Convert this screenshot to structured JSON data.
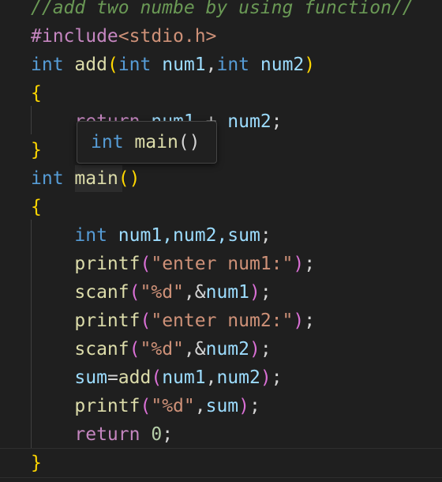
{
  "code": {
    "line1": {
      "comment": "//add two numbe by using function//"
    },
    "line2": {
      "directive": "#include",
      "header": "<stdio.h>"
    },
    "line3": {
      "kw_int": "int",
      "fn_name": "add",
      "open_paren": "(",
      "param1_type": "int",
      "param1_name": "num1",
      "comma": ",",
      "param2_type": "int",
      "param2_name": "num2",
      "close_paren": ")"
    },
    "line4": {
      "brace": "{"
    },
    "line5": {
      "kw_return": "return",
      "var1": "num1",
      "op": " + ",
      "var2": "num2",
      "semi": ";"
    },
    "line6": {
      "brace": "}"
    },
    "line7": {
      "kw_int": "int",
      "fn_name": "main",
      "parens": "()"
    },
    "line8": {
      "brace": "{"
    },
    "line9": {
      "kw_int": "int",
      "decl": "num1,num2,sum",
      "semi": ";"
    },
    "line10": {
      "fn": "printf",
      "open": "(",
      "str": "\"enter num1:\"",
      "close": ")",
      "semi": ";"
    },
    "line11": {
      "fn": "scanf",
      "open": "(",
      "str": "\"%d\"",
      "comma": ",&",
      "var": "num1",
      "close": ")",
      "semi": ";"
    },
    "line12": {
      "fn": "printf",
      "open": "(",
      "str": "\"enter num2:\"",
      "close": ")",
      "semi": ";"
    },
    "line13": {
      "fn": "scanf",
      "open": "(",
      "str": "\"%d\"",
      "comma": ",&",
      "var": "num2",
      "close": ")",
      "semi": ";"
    },
    "line14": {
      "var": "sum",
      "eq": "=",
      "fn": "add",
      "open": "(",
      "arg1": "num1",
      "comma": ",",
      "arg2": "num2",
      "close": ")",
      "semi": ";"
    },
    "line15": {
      "fn": "printf",
      "open": "(",
      "str": "\"%d\"",
      "comma": ",",
      "var": "sum",
      "close": ")",
      "semi": ";"
    },
    "line16": {
      "kw_return": "return",
      "space": " ",
      "value": "0",
      "semi": ";"
    },
    "line17": {
      "brace": "}"
    }
  },
  "hover": {
    "kw_int": "int",
    "fn_name": "main",
    "parens": "()"
  },
  "colors": {
    "background": "#1f1f1f",
    "comment": "#6a9955",
    "keyword": "#569cd6",
    "function": "#dcdcaa",
    "variable": "#9cdcfe",
    "string": "#ce9178",
    "number": "#b5cea8",
    "bracket_level1": "#ffd700",
    "bracket_level2": "#da70d6"
  }
}
